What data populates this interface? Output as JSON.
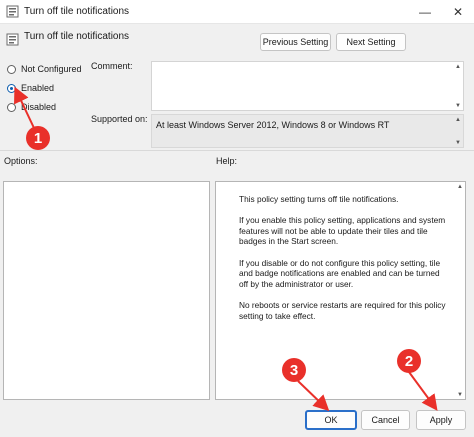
{
  "window": {
    "title": "Turn off tile notifications",
    "minimize_glyph": "—",
    "close_glyph": "✕"
  },
  "header": {
    "title": "Turn off tile notifications",
    "previous_label": "Previous Setting",
    "next_label": "Next Setting"
  },
  "state": {
    "options": [
      {
        "label": "Not Configured",
        "checked": false
      },
      {
        "label": "Enabled",
        "checked": true
      },
      {
        "label": "Disabled",
        "checked": false
      }
    ]
  },
  "comment": {
    "label": "Comment:",
    "value": ""
  },
  "supported": {
    "label": "Supported on:",
    "value": "At least Windows Server 2012, Windows 8 or Windows RT"
  },
  "panels": {
    "options_label": "Options:",
    "help_label": "Help:"
  },
  "help": {
    "paragraphs": [
      "This policy setting turns off tile notifications.",
      "If you enable this policy setting, applications and system features will not be able to update their tiles and tile badges in the Start screen.",
      "If you disable or do not configure this policy setting, tile and badge notifications are enabled and can be turned off by the administrator or user.",
      "No reboots or service restarts are required for this policy setting to take effect."
    ]
  },
  "footer": {
    "ok_label": "OK",
    "cancel_label": "Cancel",
    "apply_label": "Apply"
  },
  "annotations": {
    "badge_1": "1",
    "badge_2": "2",
    "badge_3": "3",
    "color": "#e9302a"
  },
  "icons": {
    "scroll_up": "▲",
    "scroll_down": "▼"
  }
}
